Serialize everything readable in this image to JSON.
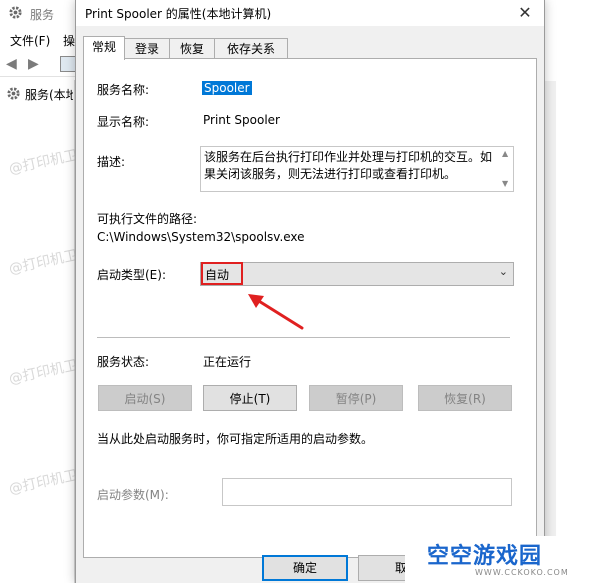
{
  "background_window": {
    "title": "服务",
    "menu": [
      "文件(F)",
      "操"
    ],
    "tree_item": "服务(本地)"
  },
  "dialog": {
    "title": "Print Spooler 的属性(本地计算机)",
    "close_glyph": "✕",
    "tabs": [
      "常规",
      "登录",
      "恢复",
      "依存关系"
    ],
    "service_name_label": "服务名称:",
    "service_name_value": "Spooler",
    "display_name_label": "显示名称:",
    "display_name_value": "Print Spooler",
    "description_label": "描述:",
    "description_value": "该服务在后台执行打印作业并处理与打印机的交互。如果关闭该服务，则无法进行打印或查看打印机。",
    "exe_path_label": "可执行文件的路径:",
    "exe_path_value": "C:\\Windows\\System32\\spoolsv.exe",
    "startup_type_label": "启动类型(E):",
    "startup_type_value": "自动",
    "status_label": "服务状态:",
    "status_value": "正在运行",
    "buttons": {
      "start": "启动(S)",
      "stop": "停止(T)",
      "pause": "暂停(P)",
      "resume": "恢复(R)"
    },
    "hint": "当从此处启动服务时，你可指定所适用的启动参数。",
    "param_label": "启动参数(M):",
    "param_value": "",
    "ok_label": "确定",
    "cancel_label": "取"
  },
  "watermark_text": "@打印机卫士",
  "logo": {
    "text": "空空游戏园",
    "url_text": "WWW.CCKOKO.COM"
  },
  "colors": {
    "accent": "#0078d7",
    "highlight_box": "#e02020",
    "logo_blue": "#1a66cc"
  }
}
